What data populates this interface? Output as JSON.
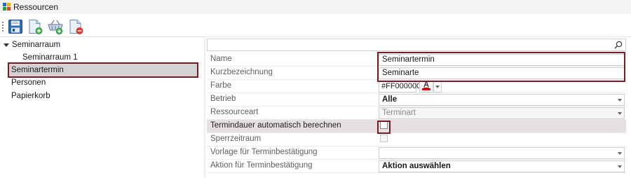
{
  "window": {
    "title": "Ressourcen",
    "icon": "app-grid-icon"
  },
  "toolbar": {
    "buttons": [
      {
        "name": "save-icon"
      },
      {
        "name": "new-document-icon"
      },
      {
        "name": "new-basket-icon"
      },
      {
        "name": "delete-document-icon"
      }
    ]
  },
  "tree": {
    "items": [
      {
        "label": "Seminarraum",
        "expanded": true
      },
      {
        "label": "Seminarraum 1"
      },
      {
        "label": "Seminartermin",
        "selected": true
      },
      {
        "label": "Personen"
      },
      {
        "label": "Papierkorb"
      }
    ]
  },
  "search": {
    "placeholder": "",
    "icon": "search-icon"
  },
  "properties": {
    "name": {
      "label": "Name",
      "value": "Seminartermin"
    },
    "short": {
      "label": "Kurzbezeichnung",
      "value": "Seminarte"
    },
    "color": {
      "label": "Farbe",
      "value": "#FF000000",
      "swatch": "#ff0000",
      "letter": "A"
    },
    "operation": {
      "label": "Betrieb",
      "value": "Alle"
    },
    "resource_type": {
      "label": "Ressourceart",
      "value": "Terminart"
    },
    "auto_duration": {
      "label": "Termindauer automatisch berechnen",
      "checked": false
    },
    "lock_period": {
      "label": "Sperrzeitraum",
      "checked": false
    },
    "template": {
      "label": "Vorlage für Terminbestätigung",
      "value": ""
    },
    "action": {
      "label": "Aktion für Terminbestätigung",
      "value": "Aktion auswählen"
    }
  },
  "colors": {
    "highlight": "#7a1a22",
    "selection": "#d3d3d3",
    "row_highlight": "#e6e0e3"
  }
}
